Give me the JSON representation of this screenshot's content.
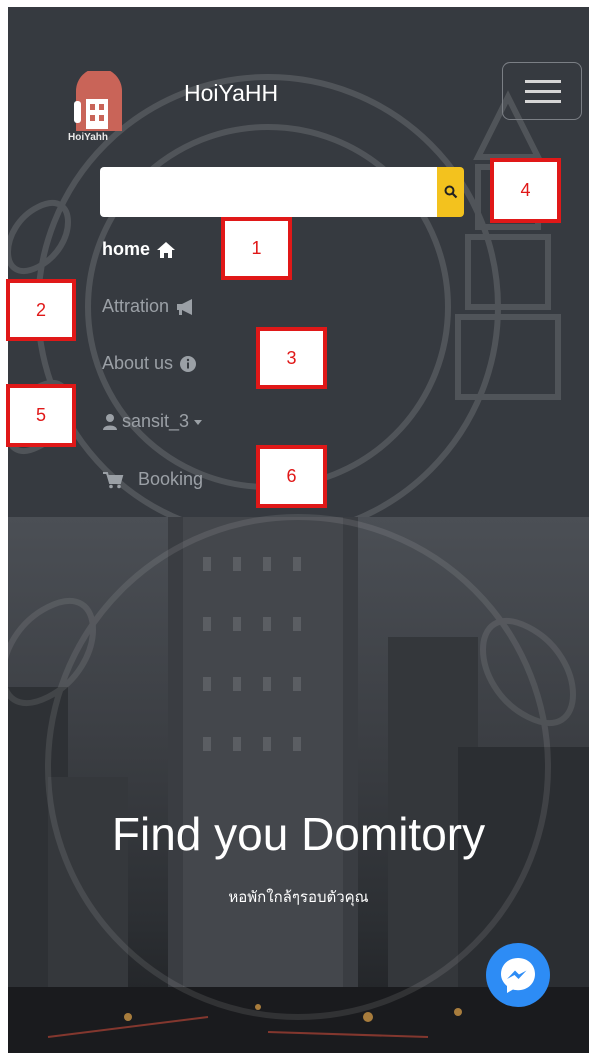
{
  "brand": {
    "name": "HoiYaHH",
    "logo_text": "HoiYahh"
  },
  "search": {
    "placeholder": "",
    "value": ""
  },
  "nav": {
    "home": "home",
    "attraction": "Attration",
    "about": "About us",
    "user": "sansit_3",
    "booking": "Booking"
  },
  "hero": {
    "title": "Find you Domitory",
    "subtitle": "หอพักใกล้ๆรอบตัวคุณ"
  },
  "markers": [
    "1",
    "2",
    "3",
    "4",
    "5",
    "6"
  ],
  "colors": {
    "accent": "#f3c21e",
    "marker": "#e01818",
    "messenger": "#2d8cf5",
    "navbar": "#363a40"
  }
}
